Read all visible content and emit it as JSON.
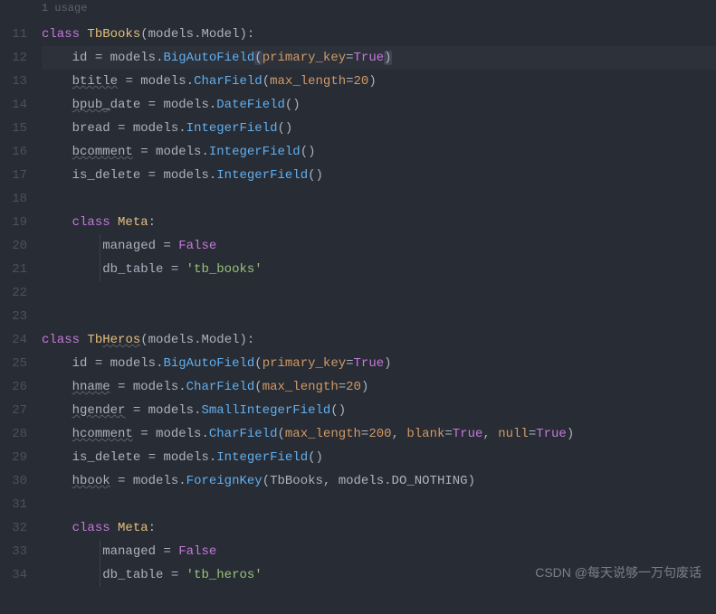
{
  "usage_hint": "1 usage",
  "lines": [
    11,
    12,
    13,
    14,
    15,
    16,
    17,
    18,
    19,
    20,
    21,
    22,
    23,
    24,
    25,
    26,
    27,
    28,
    29,
    30,
    31,
    32,
    33,
    34
  ],
  "code": {
    "class1_name": "TbBooks",
    "class2_name": "TbHeros",
    "models_module": "models",
    "model_base": "Model",
    "id_field": "id",
    "big_auto": "BigAutoField",
    "char_field": "CharField",
    "date_field": "DateField",
    "integer_field": "IntegerField",
    "small_integer_field": "SmallIntegerField",
    "foreign_key": "ForeignKey",
    "primary_key_kw": "primary_key",
    "max_length_kw": "max_length",
    "blank_kw": "blank",
    "null_kw": "null",
    "true_val": "True",
    "false_val": "False",
    "do_nothing": "DO_NOTHING",
    "btitle": "btitle",
    "bpub": "bpub_",
    "bpub_suffix": "date",
    "bread": "bread",
    "bcomment": "bcomment",
    "is_delete": "is_delete",
    "hname": "hname",
    "hgender": "hgender",
    "hcomment": "hcomment",
    "hbook": "hbook",
    "meta_cls": "Meta",
    "managed": "managed",
    "db_table": "db_table",
    "tb_books_str": "'tb_books'",
    "tb_heros_str": "'tb_heros'",
    "class_kw": "class",
    "num20": "20",
    "num200": "200"
  },
  "watermark": "CSDN @每天说够一万句废话"
}
